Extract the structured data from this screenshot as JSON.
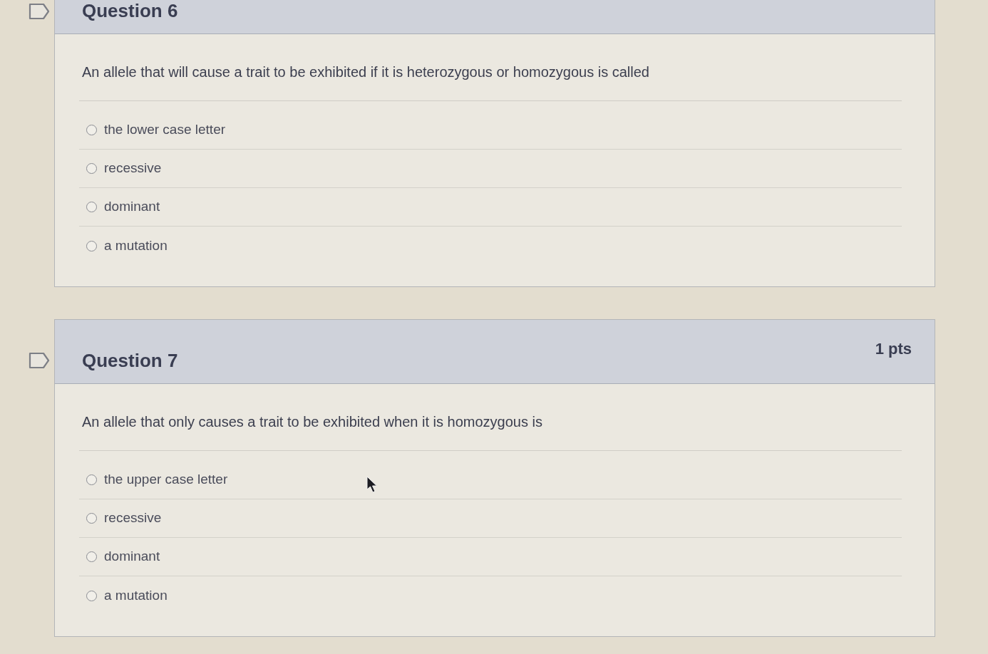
{
  "questions": [
    {
      "title": "Question 6",
      "text": "An allele that will cause a trait to be exhibited if it is heterozygous or homozygous is called",
      "answers": [
        {
          "label": "the lower case letter",
          "selected": false
        },
        {
          "label": "recessive",
          "selected": false
        },
        {
          "label": "dominant",
          "selected": false
        },
        {
          "label": "a mutation",
          "selected": false
        }
      ]
    },
    {
      "title": "Question 7",
      "points": "1 pts",
      "text": "An allele that only causes a trait to be exhibited when it is homozygous is",
      "answers": [
        {
          "label": "the upper case letter",
          "selected": false
        },
        {
          "label": "recessive",
          "selected": false
        },
        {
          "label": "dominant",
          "selected": false
        },
        {
          "label": "a mutation",
          "selected": false
        }
      ]
    }
  ]
}
